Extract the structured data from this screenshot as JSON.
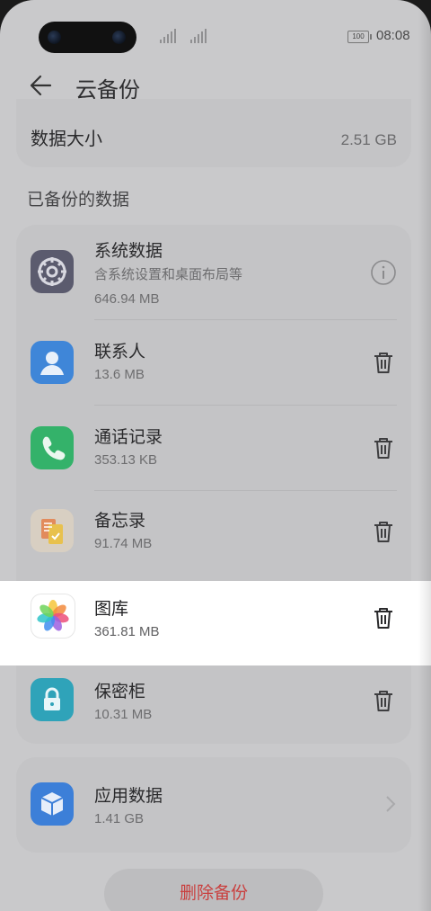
{
  "status_bar": {
    "battery": "100",
    "time": "08:08"
  },
  "header": {
    "title": "云备份"
  },
  "summary": {
    "label": "数据大小",
    "value": "2.51 GB"
  },
  "section": {
    "label": "已备份的数据"
  },
  "items": [
    {
      "title": "系统数据",
      "subtitle": "含系统设置和桌面布局等",
      "size": "646.94 MB",
      "icon": "settings-gear-icon",
      "action_icon": "info-icon",
      "icon_color": "#5b5b6e"
    },
    {
      "title": "联系人",
      "size": "13.6 MB",
      "icon": "contacts-icon",
      "action_icon": "trash-icon",
      "icon_color": "#3f86d8"
    },
    {
      "title": "通话记录",
      "size": "353.13 KB",
      "icon": "phone-icon",
      "action_icon": "trash-icon",
      "icon_color": "#34b26a"
    },
    {
      "title": "备忘录",
      "size": "91.74 MB",
      "icon": "notepad-icon",
      "action_icon": "trash-icon",
      "icon_color": "#e8c87a"
    },
    {
      "title": "图库",
      "size": "361.81 MB",
      "icon": "gallery-icon",
      "action_icon": "trash-icon",
      "icon_color": "#ffffff"
    },
    {
      "title": "保密柜",
      "size": "10.31 MB",
      "icon": "lock-icon",
      "action_icon": "trash-icon",
      "icon_color": "#2fa3b9"
    }
  ],
  "app_data": {
    "title": "应用数据",
    "size": "1.41 GB",
    "icon": "app-cube-icon",
    "icon_color": "#3c7fd8"
  },
  "footer": {
    "delete_label": "删除备份",
    "delete_color": "#c9403f"
  }
}
